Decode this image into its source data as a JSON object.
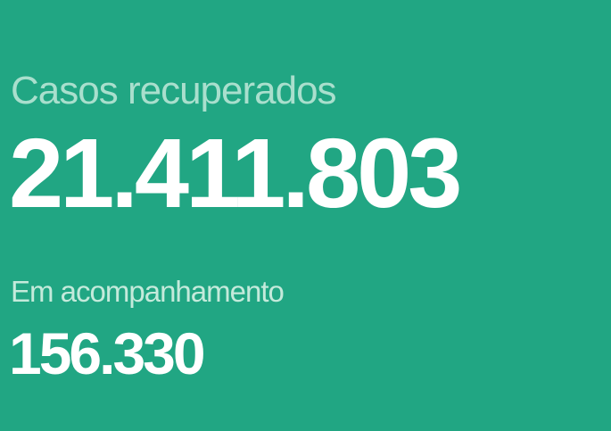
{
  "recovered": {
    "label": "Casos recuperados",
    "value": "21.411.803"
  },
  "monitoring": {
    "label": "Em acompanhamento",
    "value": "156.330"
  },
  "colors": {
    "background": "#21a683",
    "label_main": "#a9dfcd",
    "label_sub": "#c4eadb",
    "value": "#ffffff"
  }
}
